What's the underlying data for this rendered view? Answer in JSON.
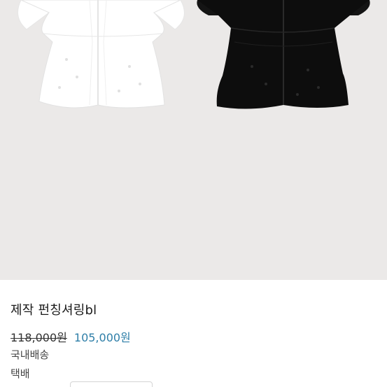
{
  "product": {
    "image_label": "product-photo",
    "title": "제작 펀칭셔링bl",
    "original_price": "118,000원",
    "sale_price": "105,000원",
    "shipping": "국내배송",
    "delivery": "택배"
  },
  "colors": {
    "image_background": "#ebe9e8",
    "sale_price": "#2f7fa8",
    "white_blouse": "#ffffff",
    "black_blouse": "#0d0d0d"
  }
}
